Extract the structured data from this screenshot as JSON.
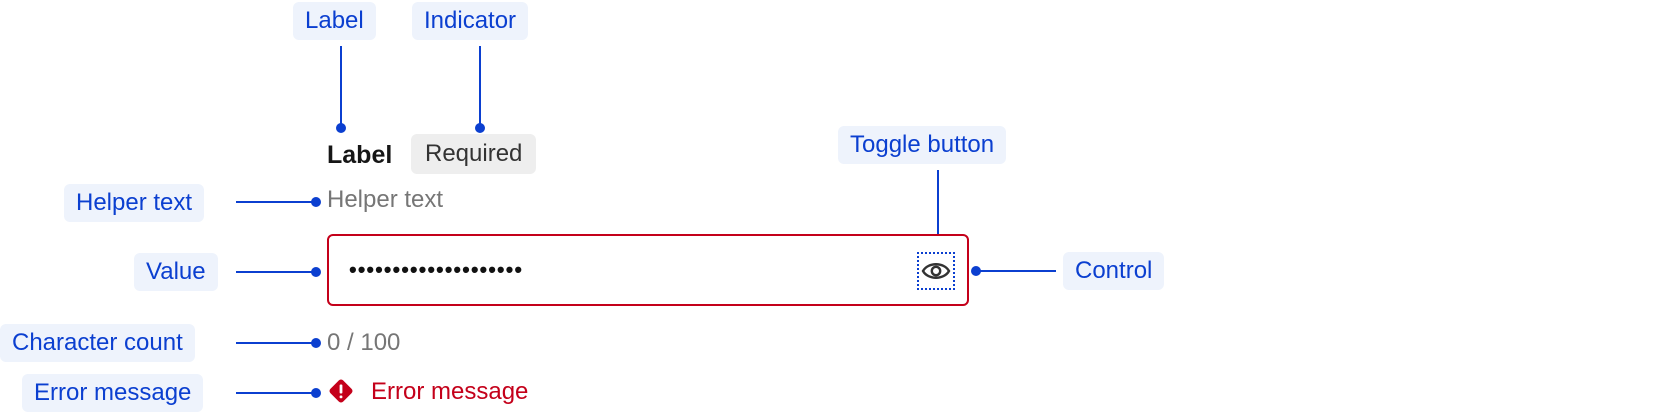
{
  "annotations": {
    "label": "Label",
    "indicator": "Indicator",
    "toggle_button": "Toggle button",
    "helper_text": "Helper text",
    "value": "Value",
    "control": "Control",
    "character_count": "Character count",
    "error_message": "Error message"
  },
  "field": {
    "label": "Label",
    "indicator": "Required",
    "helper_text": "Helper text",
    "value": "••••••••••••••••••••",
    "character_count": "0 / 100",
    "error_message": "Error message"
  },
  "colors": {
    "annotation_blue": "#0b3fd0",
    "annotation_bg": "#eef3fc",
    "error_red": "#c4001a"
  }
}
